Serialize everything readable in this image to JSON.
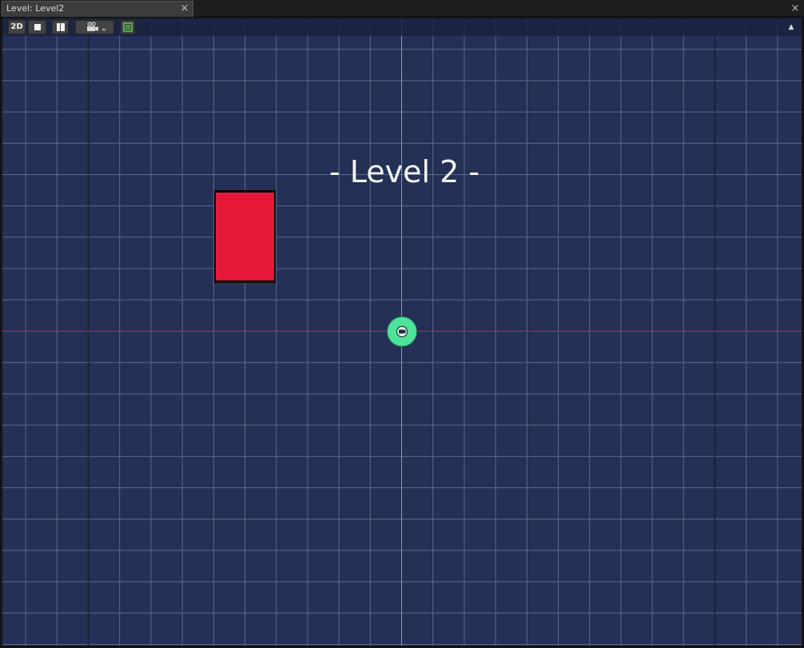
{
  "tab": {
    "title": "Level: Level2",
    "close_glyph": "×"
  },
  "window": {
    "close_glyph": "×"
  },
  "toolbar": {
    "mode_2d_label": "2D",
    "icons": [
      "square-view-icon",
      "split-view-icon",
      "camera-icon",
      "grid-snap-icon"
    ],
    "collapse_glyph": "▲"
  },
  "scene": {
    "title_text": "- Level 2 -",
    "colors": {
      "background": "#243055",
      "grid": "#5a6a8f",
      "x_axis": "#c0284a",
      "y_axis": "#36d07a",
      "block": "#e5183a",
      "camera": "#4ee29a"
    }
  }
}
